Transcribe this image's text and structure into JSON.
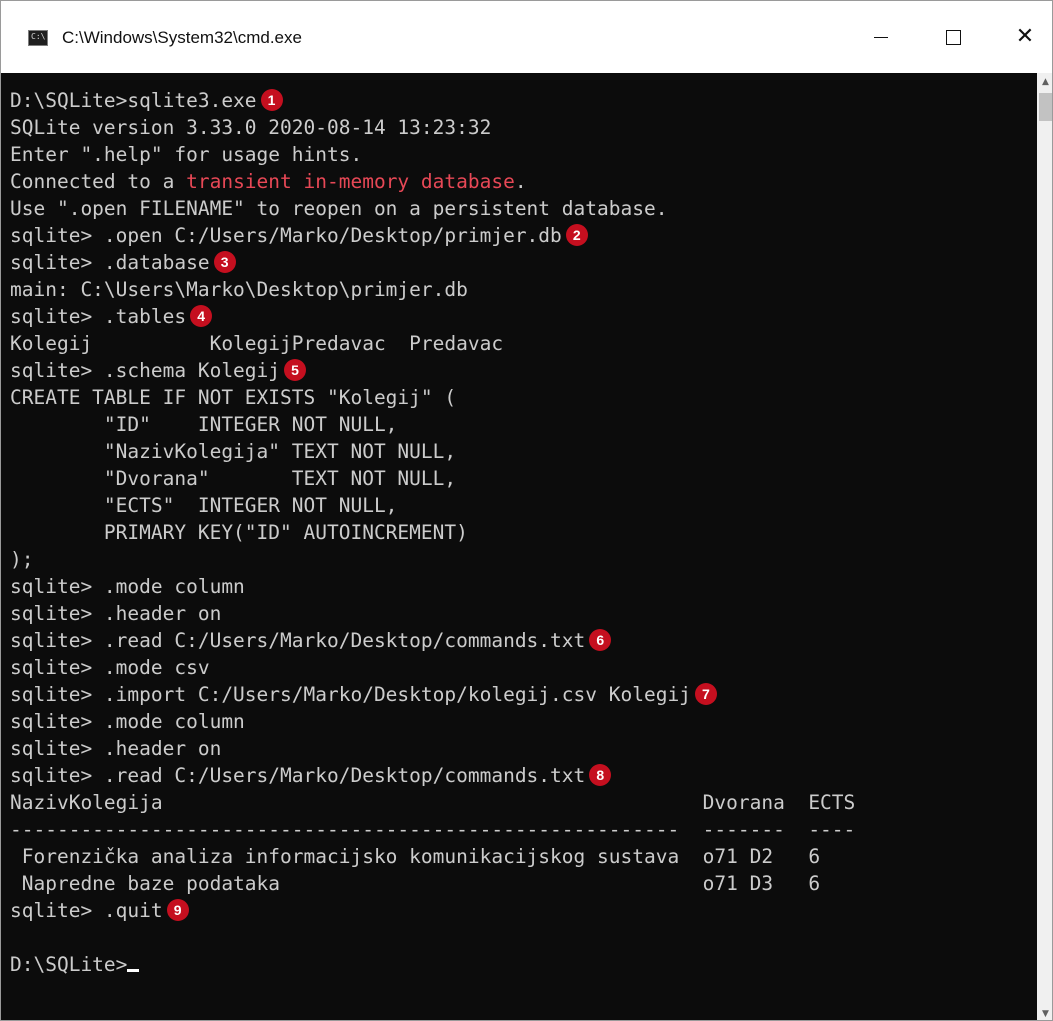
{
  "window": {
    "title": "C:\\Windows\\System32\\cmd.exe",
    "icon": "cmd-icon",
    "controls": {
      "minimize": "minimize-icon",
      "maximize": "maximize-icon",
      "close": "close-icon"
    }
  },
  "colors": {
    "console_bg": "#0c0c0c",
    "console_text": "#cccccc",
    "highlight_red": "#e74856",
    "badge_red": "#c50f1f"
  },
  "console": {
    "lines": [
      {
        "text": "D:\\SQLite>sqlite3.exe",
        "badge": "1"
      },
      {
        "text": "SQLite version 3.33.0 2020-08-14 13:23:32"
      },
      {
        "text": "Enter \".help\" for usage hints."
      },
      {
        "pre": "Connected to a ",
        "red": "transient in-memory database",
        "post": "."
      },
      {
        "text": "Use \".open FILENAME\" to reopen on a persistent database."
      },
      {
        "text": "sqlite> .open C:/Users/Marko/Desktop/primjer.db",
        "badge": "2"
      },
      {
        "text": "sqlite> .database",
        "badge": "3"
      },
      {
        "text": "main: C:\\Users\\Marko\\Desktop\\primjer.db"
      },
      {
        "text": "sqlite> .tables",
        "badge": "4"
      },
      {
        "text": "Kolegij          KolegijPredavac  Predavac"
      },
      {
        "text": "sqlite> .schema Kolegij",
        "badge": "5"
      },
      {
        "text": "CREATE TABLE IF NOT EXISTS \"Kolegij\" ("
      },
      {
        "text": "        \"ID\"    INTEGER NOT NULL,"
      },
      {
        "text": "        \"NazivKolegija\" TEXT NOT NULL,"
      },
      {
        "text": "        \"Dvorana\"       TEXT NOT NULL,"
      },
      {
        "text": "        \"ECTS\"  INTEGER NOT NULL,"
      },
      {
        "text": "        PRIMARY KEY(\"ID\" AUTOINCREMENT)"
      },
      {
        "text": ");"
      },
      {
        "text": "sqlite> .mode column"
      },
      {
        "text": "sqlite> .header on"
      },
      {
        "text": "sqlite> .read C:/Users/Marko/Desktop/commands.txt",
        "badge": "6"
      },
      {
        "text": "sqlite> .mode csv"
      },
      {
        "text": "sqlite> .import C:/Users/Marko/Desktop/kolegij.csv Kolegij",
        "badge": "7"
      },
      {
        "text": "sqlite> .mode column"
      },
      {
        "text": "sqlite> .header on"
      },
      {
        "text": "sqlite> .read C:/Users/Marko/Desktop/commands.txt",
        "badge": "8"
      },
      {
        "text": "NazivKolegija                                              Dvorana  ECTS"
      },
      {
        "text": "---------------------------------------------------------  -------  ----"
      },
      {
        "text": " Forenzička analiza informacijsko komunikacijskog sustava  o71 D2   6"
      },
      {
        "text": " Napredne baze podataka                                    o71 D3   6"
      },
      {
        "text": "sqlite> .quit",
        "badge": "9"
      },
      {
        "text": ""
      },
      {
        "text": "D:\\SQLite>",
        "cursor": true
      }
    ]
  }
}
